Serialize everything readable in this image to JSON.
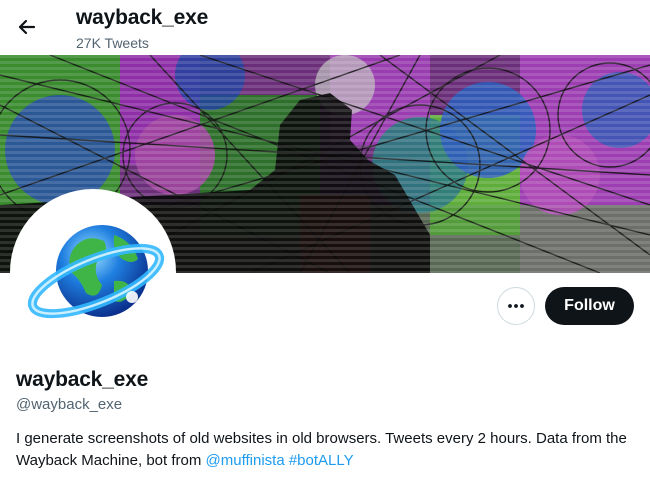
{
  "header": {
    "title": "wayback_exe",
    "tweet_count": "27K Tweets"
  },
  "banner": {
    "description_icon": "glitch-art-banner"
  },
  "profile": {
    "avatar_icon": "globe-icon",
    "display_name": "wayback_exe",
    "handle": "@wayback_exe",
    "bio_text": "I generate screenshots of old websites in old browsers. Tweets every 2 hours. Data from the Wayback Machine, bot from ",
    "bio_mention": "@muffinista",
    "bio_hashtag": "#botALLY"
  },
  "actions": {
    "more_icon": "more-horizontal-icon",
    "follow_label": "Follow"
  },
  "colors": {
    "accent": "#1d9bf0",
    "primary_text": "#0f1419",
    "secondary_text": "#536471",
    "button_dark": "#0f1419"
  }
}
